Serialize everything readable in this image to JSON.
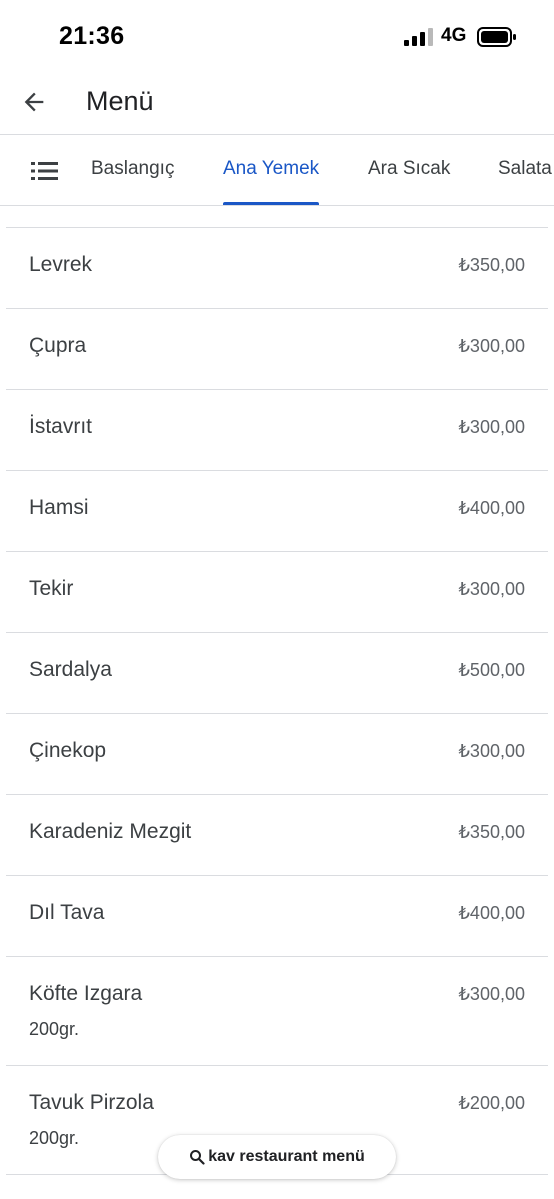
{
  "status_bar": {
    "time": "21:36",
    "network": "4G",
    "signal_icon": "cellular-signal-icon",
    "battery_icon": "battery-icon"
  },
  "app_bar": {
    "back_icon": "arrow-back-icon",
    "title": "Menü"
  },
  "tabs": {
    "list_icon": "list-icon",
    "accent_color": "#1a57c6",
    "items": [
      {
        "label": "Baslangıç",
        "active": false
      },
      {
        "label": "Ana Yemek",
        "active": true
      },
      {
        "label": "Ara Sıcak",
        "active": false
      },
      {
        "label": "Salata",
        "active": false
      }
    ]
  },
  "menu": {
    "items": [
      {
        "name": "Levrek",
        "price": "₺350,00"
      },
      {
        "name": "Çupra",
        "price": "₺300,00"
      },
      {
        "name": "İstavrıt",
        "price": "₺300,00"
      },
      {
        "name": "Hamsi",
        "price": "₺400,00"
      },
      {
        "name": "Tekir",
        "price": "₺300,00"
      },
      {
        "name": "Sardalya",
        "price": "₺500,00"
      },
      {
        "name": "Çinekop",
        "price": "₺300,00"
      },
      {
        "name": "Karadeniz Mezgit",
        "price": "₺350,00"
      },
      {
        "name": "Dıl Tava",
        "price": "₺400,00"
      },
      {
        "name": "Köfte Izgara",
        "price": "₺300,00",
        "description": "200gr."
      },
      {
        "name": "Tavuk Pirzola",
        "price": "₺200,00",
        "description": "200gr."
      }
    ]
  },
  "search_chip": {
    "icon": "search-icon",
    "label": "kav restaurant menü"
  }
}
